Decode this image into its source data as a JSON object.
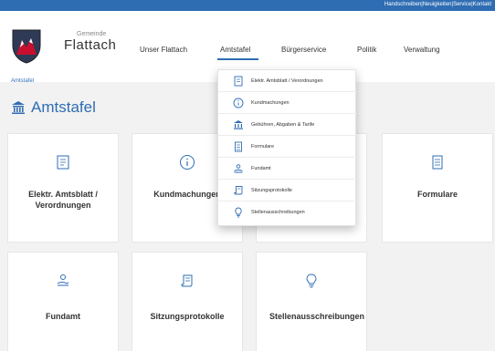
{
  "topbar": {
    "links": [
      "Handschreiben",
      "Neuigkeiten",
      "Service",
      "Kontakt"
    ],
    "separator": " | "
  },
  "brand": {
    "small": "Gemeinde",
    "name": "Flattach"
  },
  "nav": {
    "items": [
      "Unser Flattach",
      "Amtstafel",
      "Bürgerservice",
      "Politik",
      "Verwaltung"
    ],
    "active": "Amtstafel"
  },
  "breadcrumb": "Amtstafel",
  "page_title": "Amtstafel",
  "cards": [
    {
      "label": "Elektr. Amtsblatt / Verordnungen",
      "icon": "document-icon"
    },
    {
      "label": "Kundmachungen",
      "icon": "info-icon"
    },
    {
      "label": "",
      "icon": ""
    },
    {
      "label": "Formulare",
      "icon": "form-icon"
    },
    {
      "label": "Fundamt",
      "icon": "hand-icon"
    },
    {
      "label": "Sitzungsprotokolle",
      "icon": "scroll-icon"
    },
    {
      "label": "Stellenausschreibungen",
      "icon": "lightbulb-icon"
    }
  ],
  "dropdown": {
    "items": [
      {
        "label": "Elektr. Amtsblatt / Verordnungen",
        "icon": "document-icon"
      },
      {
        "label": "Kundmachungen",
        "icon": "info-icon"
      },
      {
        "label": "Gebühren, Abgaben & Tarife",
        "icon": "building-icon"
      },
      {
        "label": "Formulare",
        "icon": "form-icon"
      },
      {
        "label": "Fundamt",
        "icon": "hand-icon"
      },
      {
        "label": "Sitzungsprotokolle",
        "icon": "scroll-icon"
      },
      {
        "label": "Stellenausschreibungen",
        "icon": "lightbulb-icon"
      }
    ]
  },
  "colors": {
    "accent": "#2f6db3",
    "shield_red": "#c8102e",
    "background": "#f2f2f2"
  }
}
